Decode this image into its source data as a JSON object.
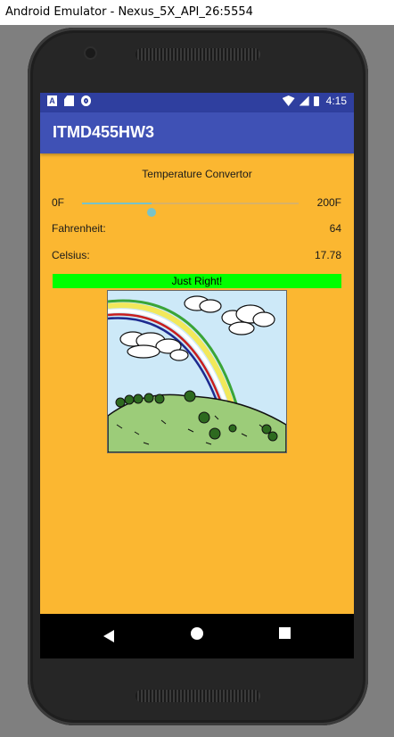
{
  "window": {
    "title": "Android Emulator - Nexus_5X_API_26:5554"
  },
  "status_bar": {
    "time": "4:15",
    "left_icons": [
      "notification-a-icon",
      "sd-card-icon",
      "record-icon"
    ],
    "right_icons": [
      "wifi-icon",
      "cell-signal-icon",
      "battery-icon"
    ]
  },
  "app_bar": {
    "title": "ITMD455HW3",
    "color": "#3f51b5"
  },
  "content": {
    "background": "#fbb731",
    "heading": "Temperature Convertor",
    "slider": {
      "min_label": "0F",
      "max_label": "200F",
      "min": 0,
      "max": 200,
      "value": 64
    },
    "fahrenheit": {
      "label": "Fahrenheit:",
      "value": "64"
    },
    "celsius": {
      "label": "Celsius:",
      "value": "17.78"
    },
    "message": {
      "text": "Just Right!",
      "color": "#00ff00"
    },
    "image": {
      "name": "rainbow-hill-icon"
    }
  },
  "nav_bar": {
    "buttons": [
      "back-icon",
      "home-icon",
      "recents-icon"
    ]
  }
}
